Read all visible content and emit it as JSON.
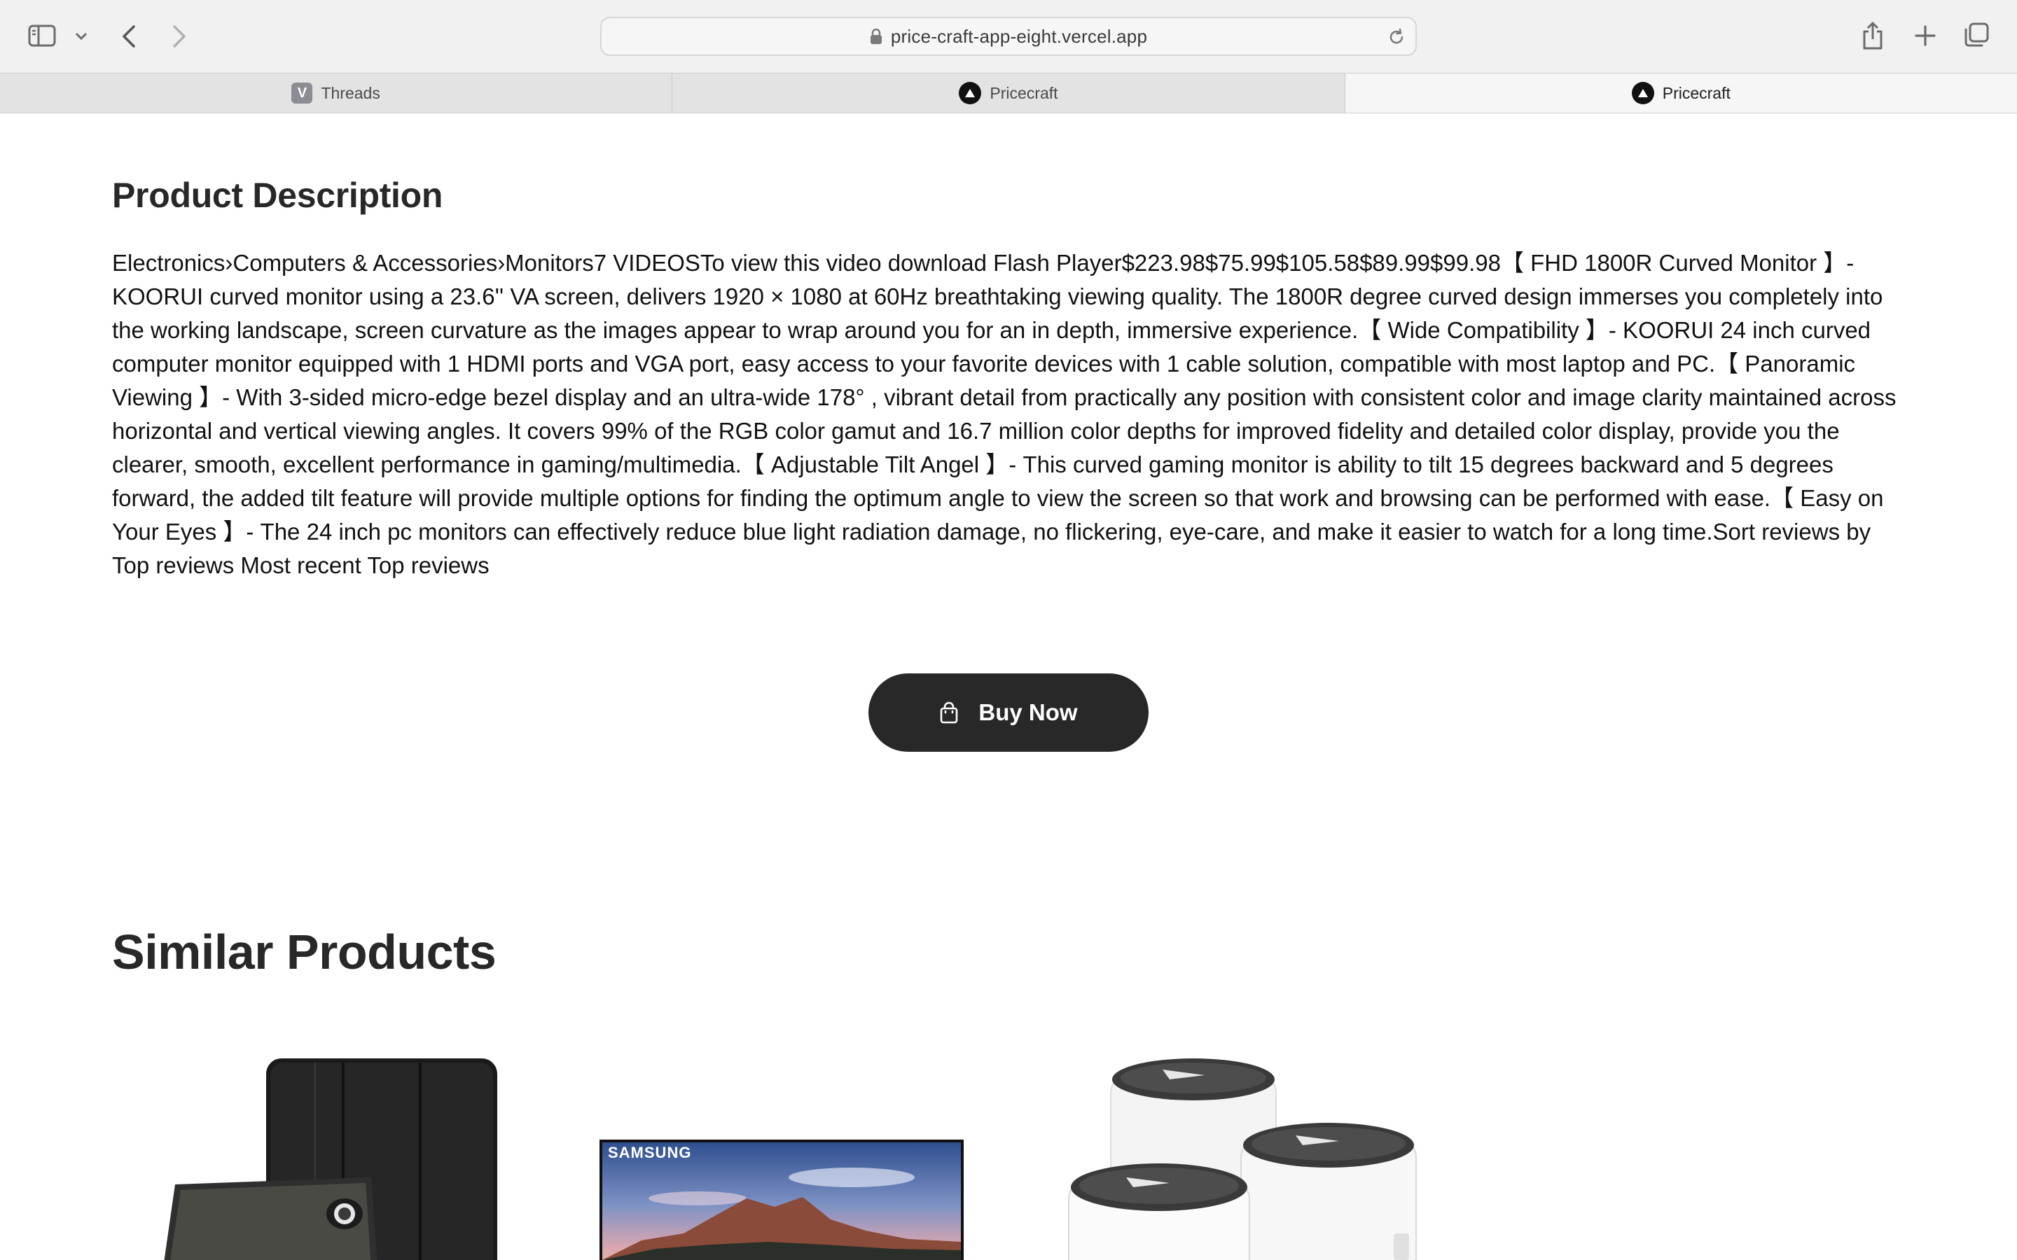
{
  "browser": {
    "url": "price-craft-app-eight.vercel.app",
    "tabs": [
      {
        "label": "Threads",
        "favicon": "V",
        "active": false
      },
      {
        "label": "Pricecraft",
        "favicon": "triangle",
        "active": false
      },
      {
        "label": "Pricecraft",
        "favicon": "triangle",
        "active": true
      }
    ]
  },
  "product": {
    "description_heading": "Product Description",
    "description_text": "Electronics›Computers & Accessories›Monitors7 VIDEOSTo view this video download Flash Player$223.98$75.99$105.58$89.99$99.98【 FHD 1800R Curved Monitor 】- KOORUI curved monitor using a 23.6'' VA screen, delivers 1920 × 1080 at 60Hz breathtaking viewing quality. The 1800R degree curved design immerses you completely into the working landscape, screen curvature as the images appear to wrap around you for an in depth, immersive experience.【 Wide Compatibility 】- KOORUI 24 inch curved computer monitor equipped with 1 HDMI ports and VGA port, easy access to your favorite devices with 1 cable solution, compatible with most laptop and PC.【 Panoramic Viewing 】- With 3-sided micro-edge bezel display and an ultra-wide 178° , vibrant detail from practically any position with consistent color and image clarity maintained across horizontal and vertical viewing angles. It covers 99% of the RGB color gamut and 16.7 million color depths for improved fidelity and detailed color display, provide you the clearer, smooth, excellent performance in gaming/multimedia.【 Adjustable Tilt Angel 】- This curved gaming monitor is ability to tilt 15 degrees backward and 5 degrees forward, the added tilt feature will provide multiple options for finding the optimum angle to view the screen so that work and browsing can be performed with ease.【 Easy on Your Eyes 】- The 24 inch pc monitors can effectively reduce blue light radiation damage, no flickering, eye-care, and make it easier to watch for a long time.Sort reviews by Top reviews Most recent Top reviews",
    "buy_button_label": "Buy Now"
  },
  "similar": {
    "heading": "Similar Products",
    "items": [
      {
        "icon": "tablet-case-image"
      },
      {
        "icon": "monitor-image",
        "brand_text": "SAMSUNG"
      },
      {
        "icon": "mesh-router-image"
      }
    ]
  },
  "colors": {
    "button_bg": "#282828",
    "heading": "#282828"
  }
}
